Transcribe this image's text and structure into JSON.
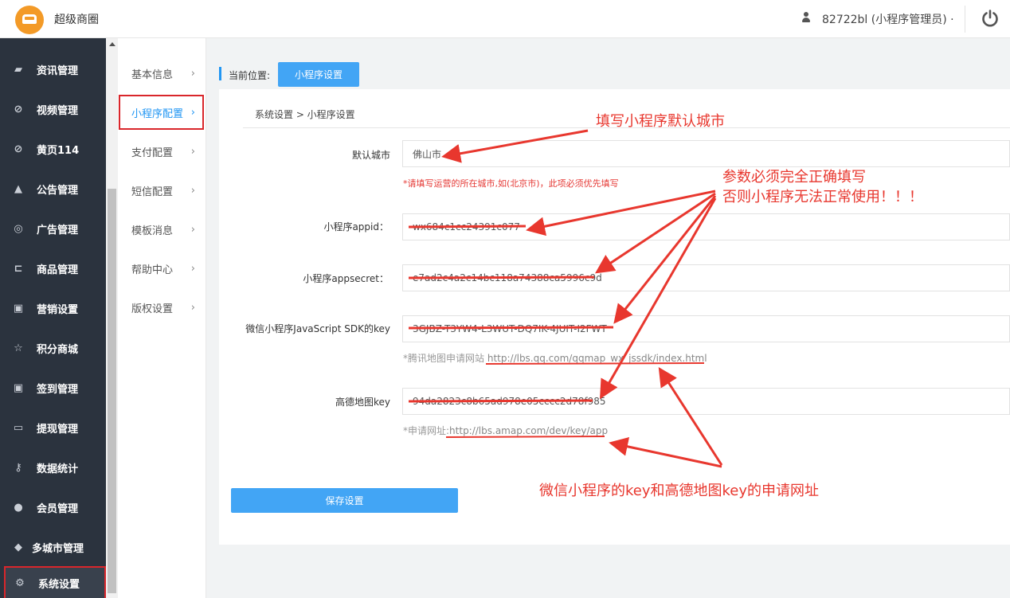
{
  "app": {
    "title": "超级商圈",
    "user": "82722bl (小程序管理员) ·"
  },
  "sidebar": {
    "items": [
      {
        "label": "资讯管理",
        "icon": "book-icon"
      },
      {
        "label": "视频管理",
        "icon": "compass-icon"
      },
      {
        "label": "黄页114",
        "icon": "compass-icon"
      },
      {
        "label": "公告管理",
        "icon": "bell-icon"
      },
      {
        "label": "广告管理",
        "icon": "lifebuoy-icon"
      },
      {
        "label": "商品管理",
        "icon": "cart-icon"
      },
      {
        "label": "营销设置",
        "icon": "gift-icon"
      },
      {
        "label": "积分商城",
        "icon": "star-icon"
      },
      {
        "label": "签到管理",
        "icon": "gift-icon"
      },
      {
        "label": "提现管理",
        "icon": "money-icon"
      },
      {
        "label": "数据统计",
        "icon": "key-icon"
      },
      {
        "label": "会员管理",
        "icon": "user-icon"
      },
      {
        "label": "多城市管理",
        "icon": "graduation-cap-icon"
      },
      {
        "label": "系统设置",
        "icon": "gear-icon"
      }
    ]
  },
  "subnav": {
    "items": [
      {
        "label": "基本信息"
      },
      {
        "label": "小程序配置"
      },
      {
        "label": "支付配置"
      },
      {
        "label": "短信配置"
      },
      {
        "label": "模板消息"
      },
      {
        "label": "帮助中心"
      },
      {
        "label": "版权设置"
      }
    ]
  },
  "breadcrumb": {
    "label": "当前位置:",
    "current": "小程序设置",
    "path": "系统设置 > 小程序设置"
  },
  "form": {
    "city_label": "默认城市",
    "city_value": "佛山市",
    "city_hint": "*请填写运营的所在城市,如(北京市)，此项必须优先填写",
    "appid_label": "小程序appid：",
    "appid_value": "wx684c1cc24391c077",
    "secret_label": "小程序appsecret：",
    "secret_value": "e7ad2c4a2c14bc118a74388ca5996c9d",
    "sdk_label": "微信小程序JavaScript SDK的key",
    "sdk_value": "3GJBZ-T3YW4-L3WUT-DQ7IK-4JUIT-I2FWT",
    "sdk_hint_prefix": "*腾讯地图申请网站",
    "sdk_hint_url": "http://lbs.qq.com/qqmap_wx_jssdk/index.html",
    "amap_label": "高德地图key",
    "amap_value": "94da2823c8b65ad978e05cccc2d78f985",
    "amap_hint_prefix": "*申请网址:",
    "amap_hint_url": "http://lbs.amap.com/dev/key/app",
    "save_label": "保存设置"
  },
  "annotations": {
    "city": "填写小程序默认城市",
    "params_line1": "参数必须完全正确填写",
    "params_line2": "否则小程序无法正常使用！！！",
    "keys_url": "微信小程序的key和高德地图key的申请网址"
  },
  "colors": {
    "sidebar_bg": "#2b333e",
    "accent": "#42a5f5",
    "annotation_red": "#e8372e",
    "highlight_red": "#d9262b"
  }
}
